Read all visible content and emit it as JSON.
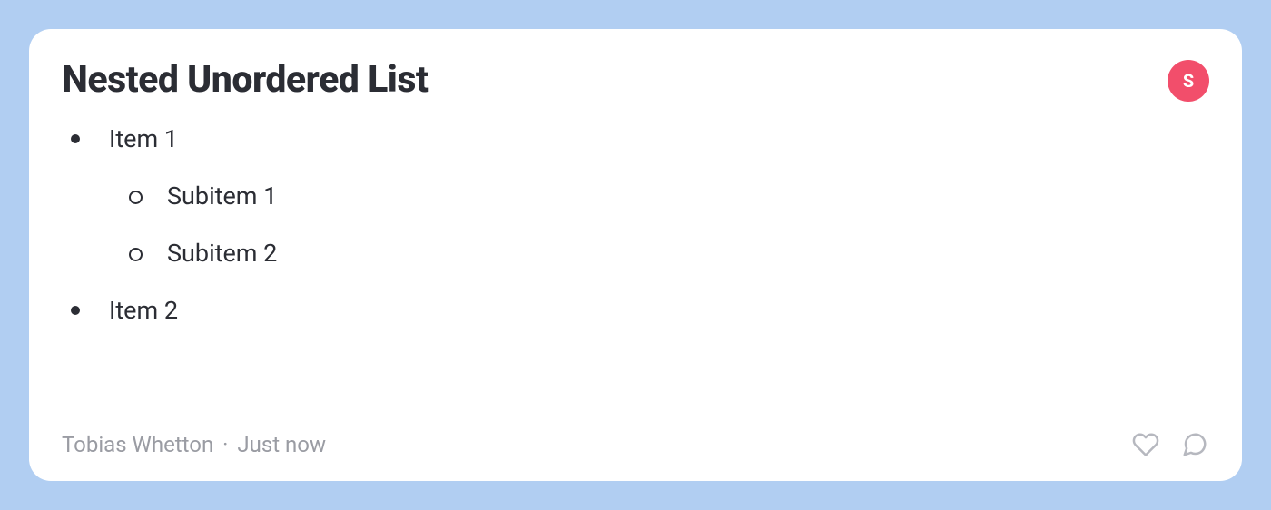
{
  "card": {
    "title": "Nested Unordered List",
    "avatar_label": "S",
    "list": {
      "items": [
        {
          "label": "Item 1",
          "subitems": [
            {
              "label": "Subitem 1"
            },
            {
              "label": "Subitem 2"
            }
          ]
        },
        {
          "label": "Item 2",
          "subitems": []
        }
      ]
    },
    "meta": {
      "author": "Tobias Whetton",
      "separator": "·",
      "time": "Just now"
    },
    "icons": {
      "like": "heart-icon",
      "comment": "comment-icon"
    }
  },
  "colors": {
    "background": "#b1cef2",
    "card_bg": "#ffffff",
    "text_primary": "#2b2d34",
    "text_muted": "#9a9ca3",
    "avatar_bg": "#f24e6b",
    "icon_muted": "#b6b8bf"
  }
}
